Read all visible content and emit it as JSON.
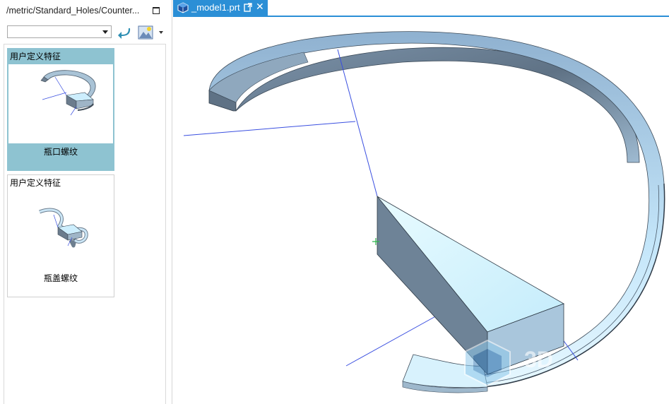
{
  "library": {
    "path": "/metric/Standard_Holes/Counter...",
    "selected_value": ""
  },
  "udf_list": [
    {
      "category": "用户定义特征",
      "name": "瓶口螺纹",
      "selected": true
    },
    {
      "category": "用户定义特征",
      "name": "瓶盖螺纹",
      "selected": false
    }
  ],
  "document_tab": {
    "label": "_model1.prt"
  },
  "watermark": {
    "text": "3D"
  },
  "colors": {
    "tab_accent": "#2b8fd6",
    "selected_card": "#8ec3d1",
    "datum_axis": "#3a4fe0",
    "model_face": "#a9c6dc",
    "model_light": "#cfefff",
    "model_dark": "#5f7184"
  }
}
